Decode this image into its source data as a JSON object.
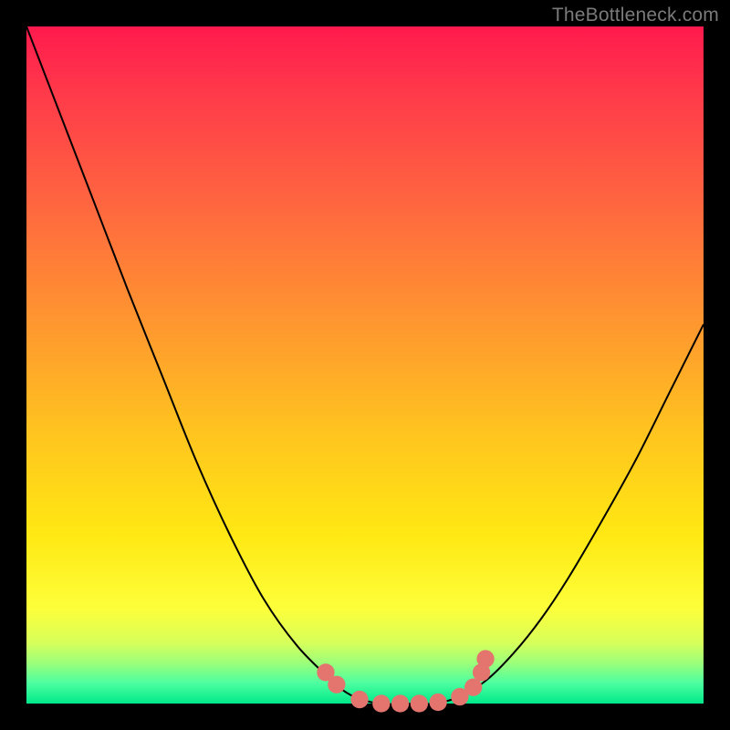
{
  "watermark": "TheBottleneck.com",
  "chart_data": {
    "type": "line",
    "title": "",
    "xlabel": "",
    "ylabel": "",
    "xlim": [
      0,
      1
    ],
    "ylim": [
      0,
      1
    ],
    "gradient_stops": [
      {
        "pos": 0.0,
        "color": "#ff1a4d"
      },
      {
        "pos": 0.1,
        "color": "#ff3a4a"
      },
      {
        "pos": 0.28,
        "color": "#ff6b3e"
      },
      {
        "pos": 0.45,
        "color": "#ff9a2e"
      },
      {
        "pos": 0.6,
        "color": "#ffc41f"
      },
      {
        "pos": 0.75,
        "color": "#ffe813"
      },
      {
        "pos": 0.86,
        "color": "#fdff3a"
      },
      {
        "pos": 0.91,
        "color": "#d7ff5a"
      },
      {
        "pos": 0.94,
        "color": "#9cff7a"
      },
      {
        "pos": 0.97,
        "color": "#4cffa0"
      },
      {
        "pos": 1.0,
        "color": "#00e88a"
      }
    ],
    "series": [
      {
        "name": "bottleneck-curve",
        "x": [
          0.0,
          0.05,
          0.1,
          0.15,
          0.2,
          0.25,
          0.3,
          0.35,
          0.4,
          0.45,
          0.48,
          0.52,
          0.56,
          0.6,
          0.64,
          0.68,
          0.72,
          0.76,
          0.8,
          0.85,
          0.9,
          0.95,
          1.0
        ],
        "y": [
          1.0,
          0.87,
          0.74,
          0.61,
          0.485,
          0.36,
          0.25,
          0.155,
          0.085,
          0.035,
          0.012,
          0.0,
          0.0,
          0.0,
          0.01,
          0.035,
          0.075,
          0.125,
          0.185,
          0.27,
          0.36,
          0.46,
          0.56
        ]
      }
    ],
    "markers": {
      "name": "highlight-dots",
      "color": "#e4746e",
      "radius_frac": 0.013,
      "points": [
        {
          "x": 0.442,
          "y": 0.046
        },
        {
          "x": 0.458,
          "y": 0.028
        },
        {
          "x": 0.492,
          "y": 0.006
        },
        {
          "x": 0.524,
          "y": 0.0
        },
        {
          "x": 0.552,
          "y": 0.0
        },
        {
          "x": 0.58,
          "y": 0.0
        },
        {
          "x": 0.608,
          "y": 0.002
        },
        {
          "x": 0.64,
          "y": 0.01
        },
        {
          "x": 0.66,
          "y": 0.024
        },
        {
          "x": 0.672,
          "y": 0.046
        },
        {
          "x": 0.678,
          "y": 0.066
        }
      ]
    }
  }
}
